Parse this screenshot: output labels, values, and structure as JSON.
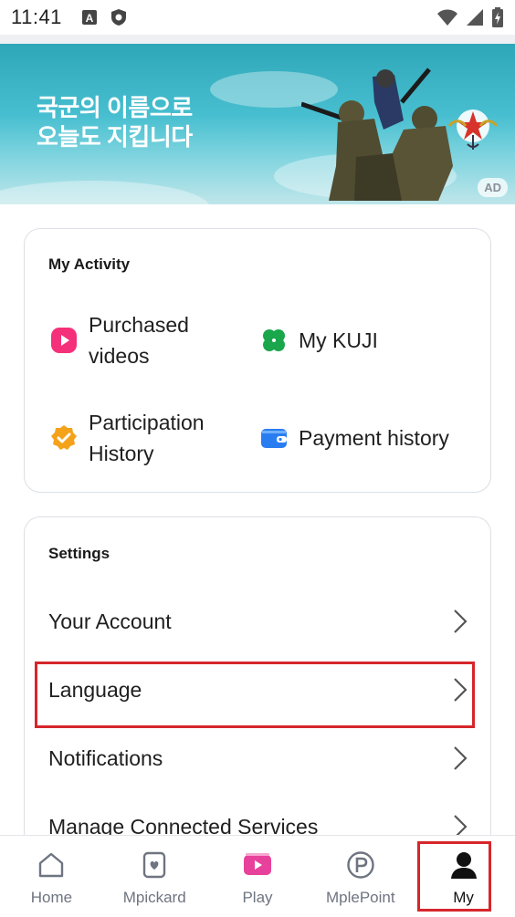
{
  "status_bar": {
    "time": "11:41"
  },
  "banner": {
    "line1": "국군의 이름으로",
    "line2": "오늘도 지킵니다",
    "ad_badge": "AD"
  },
  "activity": {
    "title": "My Activity",
    "items": [
      {
        "label": "Purchased videos",
        "icon": "play-icon",
        "color": "#f5307a"
      },
      {
        "label": "My KUJI",
        "icon": "clover-icon",
        "color": "#1aa64a"
      },
      {
        "label": "Participation History",
        "icon": "check-badge-icon",
        "color": "#f5a21b"
      },
      {
        "label": "Payment history",
        "icon": "wallet-icon",
        "color": "#2a7df0"
      }
    ]
  },
  "settings": {
    "title": "Settings",
    "items": [
      {
        "label": "Your Account"
      },
      {
        "label": "Language"
      },
      {
        "label": "Notifications"
      },
      {
        "label": "Manage Connected Services"
      }
    ]
  },
  "bottom_nav": {
    "tabs": [
      {
        "label": "Home",
        "icon": "home-icon"
      },
      {
        "label": "Mpickard",
        "icon": "mpickard-icon"
      },
      {
        "label": "Play",
        "icon": "play-tab-icon",
        "color": "#e7419c"
      },
      {
        "label": "MplePoint",
        "icon": "point-icon"
      },
      {
        "label": "My",
        "icon": "person-icon",
        "active": true
      }
    ]
  }
}
